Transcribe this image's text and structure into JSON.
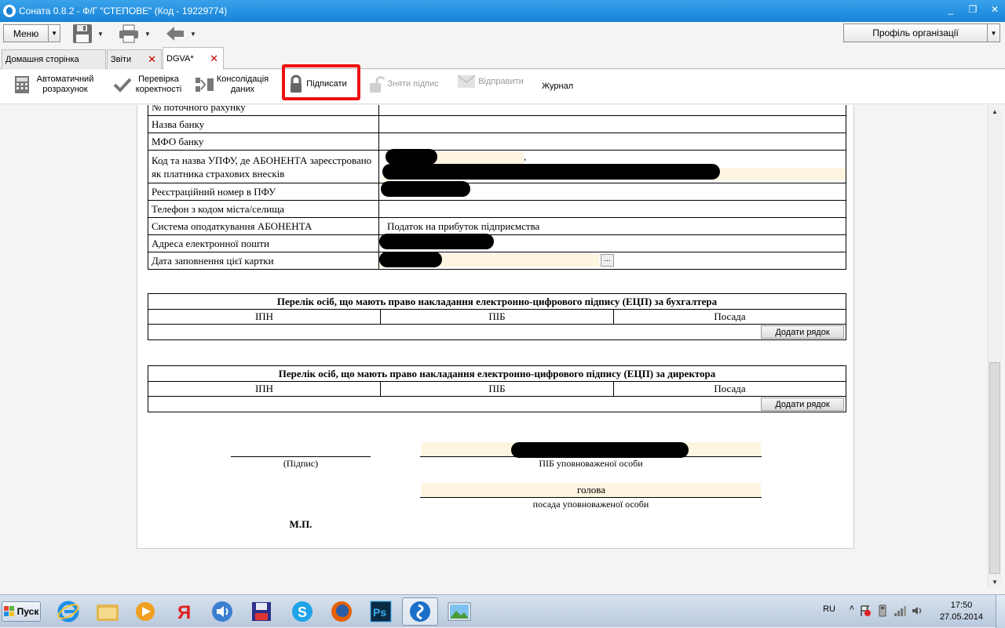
{
  "window": {
    "title": "Соната 0.8.2 - Ф/Г \"СТЕПОВЕ\" (Код - 19229774)",
    "minimize": "_",
    "restore": "❐",
    "close": "✕"
  },
  "toolbar": {
    "menu_label": "Меню",
    "profile_label": "Профіль організації"
  },
  "tabs": [
    {
      "label": "Домашня сторінка"
    },
    {
      "label": "Звіти",
      "close": "✕"
    },
    {
      "label": "DGVA*",
      "close": "✕"
    }
  ],
  "actions": {
    "auto_calc": "Автоматичний розрахунок",
    "check": "Перевірка коректності",
    "consolidate": "Консолідація даних",
    "sign": "Підписати",
    "unsign": "Зняти підпис",
    "send": "Відправити",
    "journal": "Журнал"
  },
  "form": {
    "rows": [
      {
        "label": "№ поточного рахунку",
        "value": ""
      },
      {
        "label": "Назва банку",
        "value": ""
      },
      {
        "label": "МФО банку",
        "value": ""
      },
      {
        "label": "Код та назва УПФУ, де АБОНЕНТА зареєстровано як платника страхових внесків",
        "value": ","
      },
      {
        "label": "Реєстраційний номер в ПФУ",
        "value": ""
      },
      {
        "label": "Телефон з кодом міста/селища",
        "value": ""
      },
      {
        "label": "Система оподаткування АБОНЕНТА",
        "value": "Податок на прибуток підприємства"
      },
      {
        "label": "Адреса електронної пошти",
        "value": ""
      },
      {
        "label": "Дата заповнення цієї картки",
        "value": ""
      }
    ],
    "date_picker_label": "..."
  },
  "accountant_block": {
    "title": "Перелік осіб, що мають право накладання електронно-цифрового підпису (ЕЦП) за бухгалтера",
    "columns": [
      "ІПН",
      "ПІБ",
      "Посада"
    ],
    "add_row": "Додати рядок"
  },
  "director_block": {
    "title": "Перелік осіб, що мають право накладання електронно-цифрового підпису (ЕЦП) за директора",
    "columns": [
      "ІПН",
      "ПІБ",
      "Посада"
    ],
    "add_row": "Додати рядок"
  },
  "signature": {
    "sign_label": "(Підпис)",
    "pib_label": "ПІБ уповноваженої особи",
    "position_value": "голова",
    "position_label": "посада уповноваженої особи",
    "stamp": "М.П."
  },
  "taskbar": {
    "start_label": "Пуск",
    "lang": "RU",
    "time": "17:50",
    "date": "27.05.2014"
  },
  "colors": {
    "titlebar": "#1683d8",
    "fill": "#fdf5e0",
    "highlight": "#ee1111"
  }
}
